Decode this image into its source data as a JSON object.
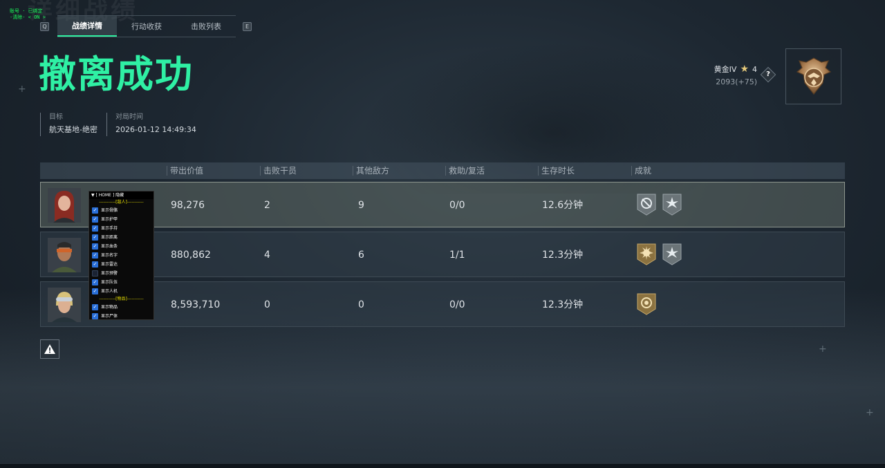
{
  "overlay": {
    "line1": "账号 · 已绑定",
    "line2": "-清除-  < ON >"
  },
  "watermark": "详细战绩",
  "tabs": {
    "left_key": "Q",
    "right_key": "E",
    "items": [
      {
        "label": "战绩详情",
        "active": true
      },
      {
        "label": "行动收获",
        "active": false
      },
      {
        "label": "击败列表",
        "active": false
      }
    ]
  },
  "result_title": "撤离成功",
  "info": {
    "target_label": "目标",
    "target_value": "航天基地-绝密",
    "time_label": "对局时间",
    "time_value": "2026-01-12 14:49:34"
  },
  "rank": {
    "tier": "黄金IV",
    "stars": "4",
    "score": "2093(+75)",
    "help": "?"
  },
  "table": {
    "headers": [
      "带出价值",
      "击败干员",
      "其他敌方",
      "救助/复活",
      "生存时长",
      "成就"
    ],
    "rows": [
      {
        "value": "98,276",
        "kills": "2",
        "others": "9",
        "assist": "0/0",
        "survival": "12.6分钟",
        "highlight": true
      },
      {
        "value": "880,862",
        "kills": "4",
        "others": "6",
        "assist": "1/1",
        "survival": "12.3分钟",
        "highlight": false
      },
      {
        "value": "8,593,710",
        "kills": "0",
        "others": "0",
        "assist": "0/0",
        "survival": "12.3分钟",
        "highlight": false
      }
    ]
  },
  "cheat_menu": {
    "header": "▼ [ HOME ] 隐藏",
    "section1": "-----------[敌人]-----------",
    "items1": [
      {
        "label": "显示骨骼",
        "on": true
      },
      {
        "label": "显示护甲",
        "on": true
      },
      {
        "label": "显示手持",
        "on": true
      },
      {
        "label": "显示距离",
        "on": true
      },
      {
        "label": "显示血条",
        "on": true
      },
      {
        "label": "显示名字",
        "on": true
      },
      {
        "label": "显示雷达",
        "on": true
      },
      {
        "label": "显示预警",
        "on": false
      },
      {
        "label": "显示队伍",
        "on": true
      },
      {
        "label": "显示人机",
        "on": true
      }
    ],
    "section2": "-----------[物品]-----------",
    "items2": [
      {
        "label": "显示物品",
        "on": true
      },
      {
        "label": "显示尸体",
        "on": true
      }
    ]
  },
  "colors": {
    "accent_green": "#2ff0a4",
    "rank_star": "#e5c97a",
    "checkbox_blue": "#2a6fd8"
  }
}
